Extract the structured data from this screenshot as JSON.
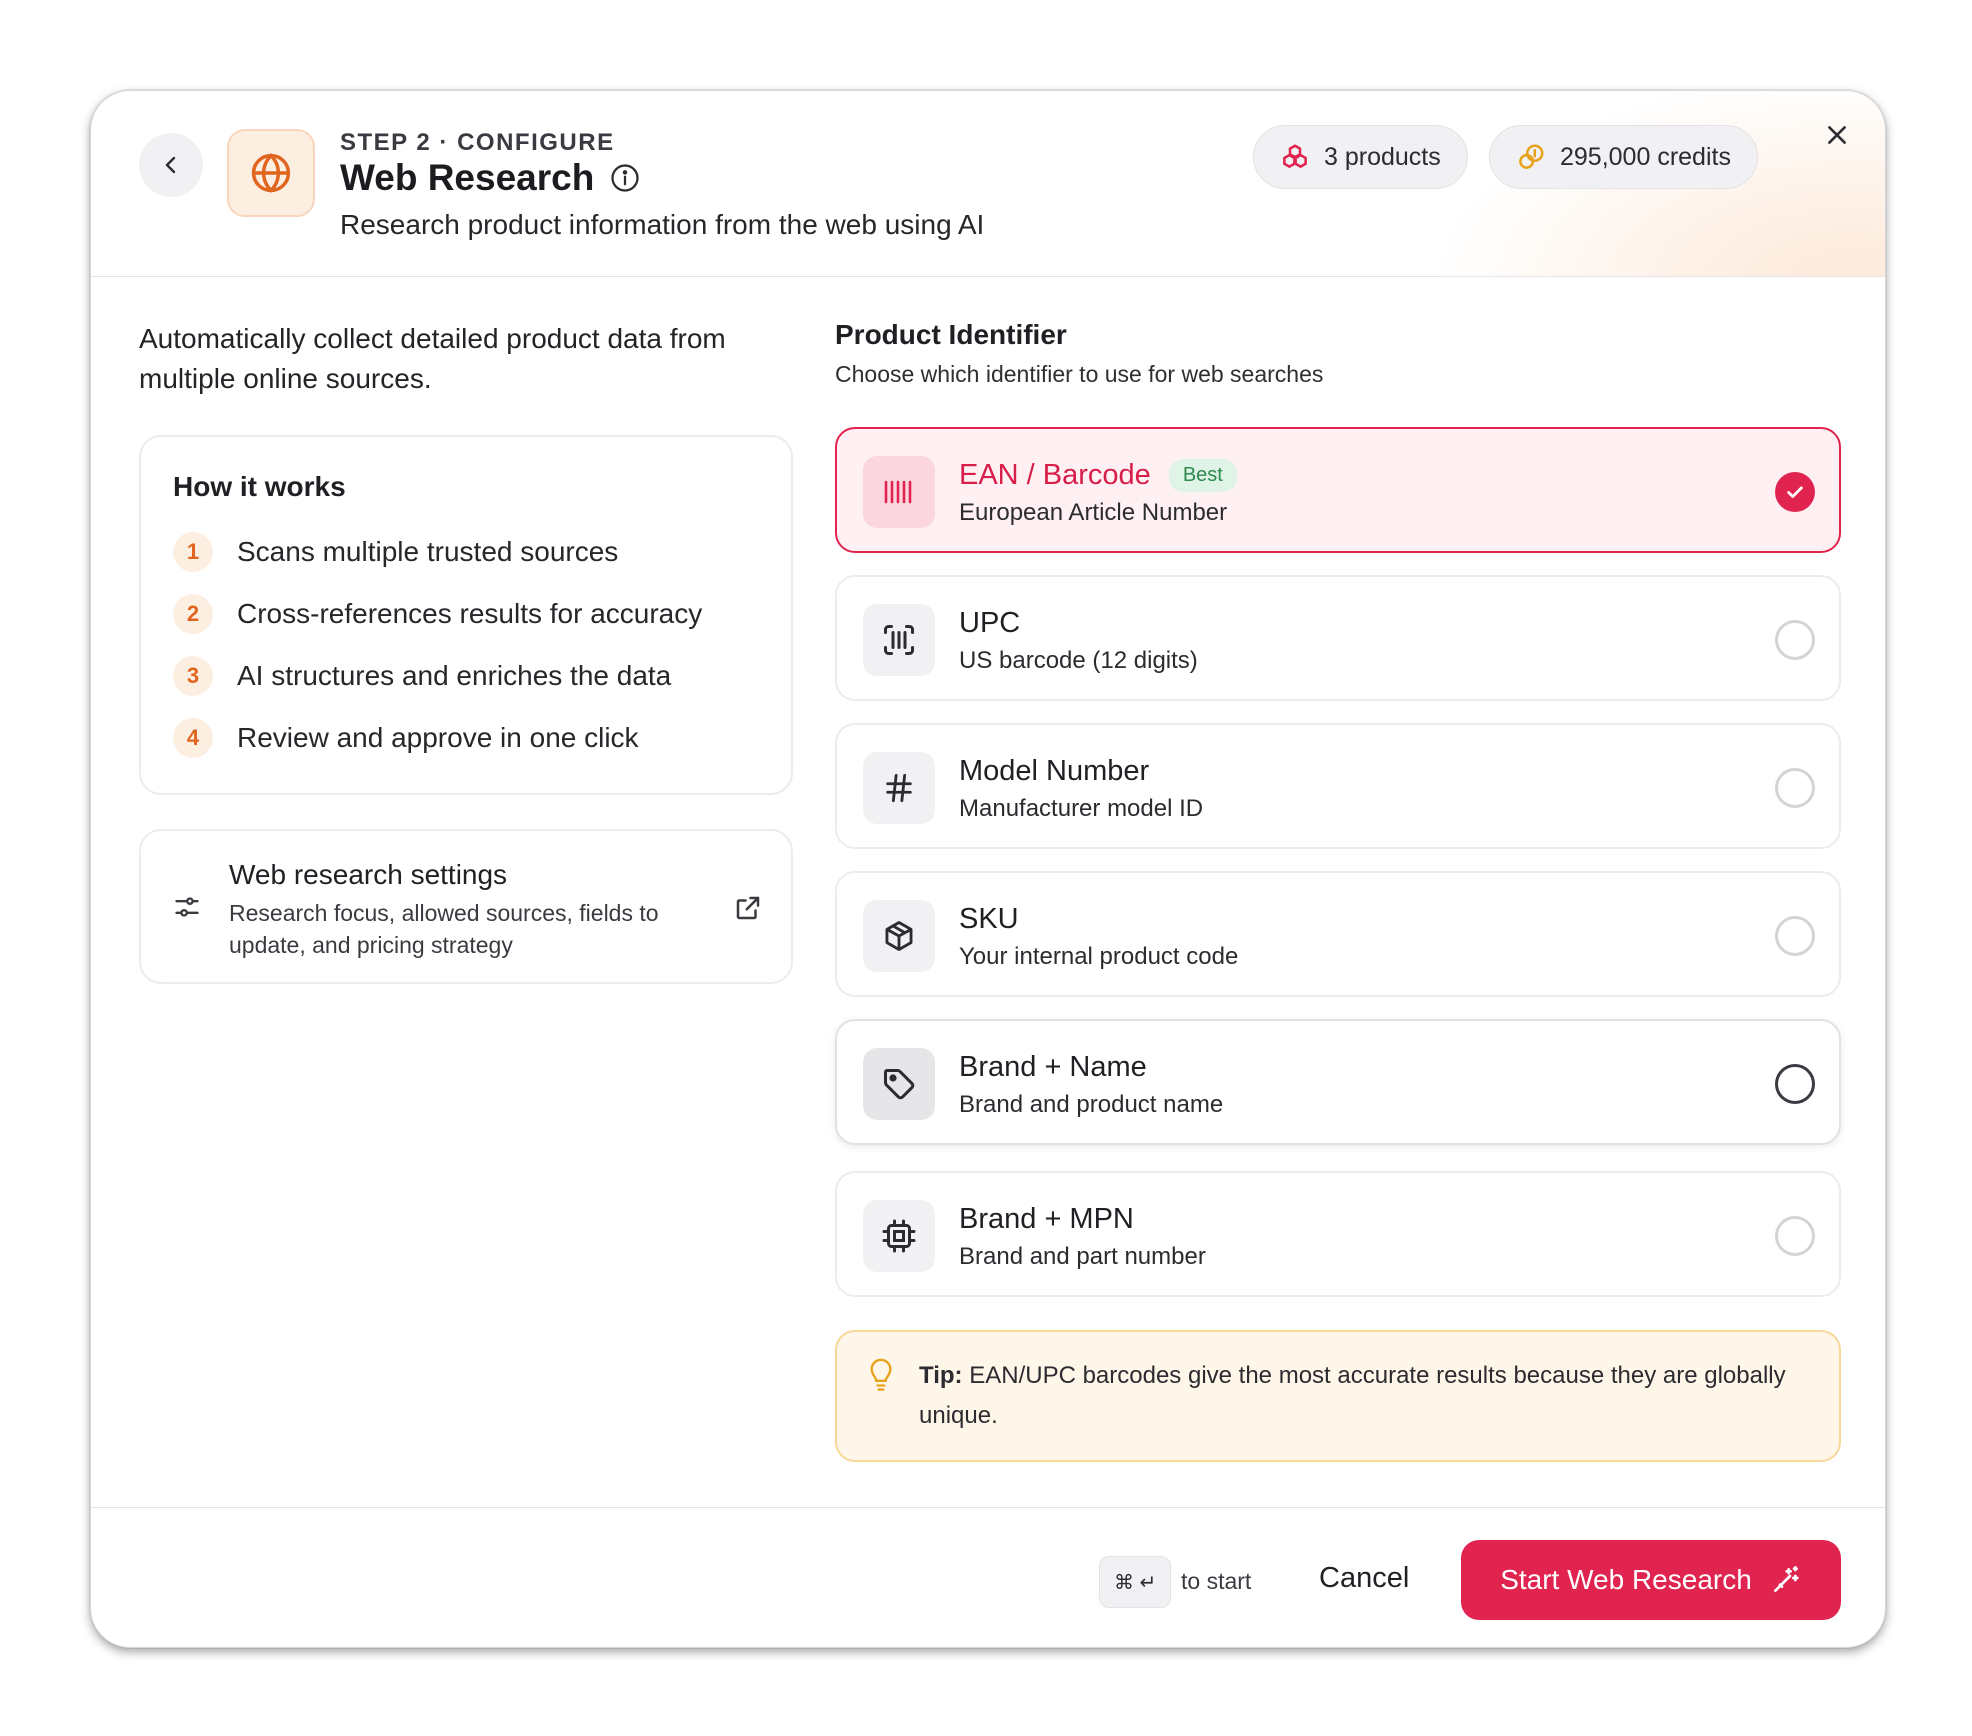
{
  "header": {
    "step": "STEP 2 · CONFIGURE",
    "title": "Web Research",
    "subtitle": "Research product information from the web using AI",
    "products_pill": "3 products",
    "credits_pill": "295,000 credits"
  },
  "left": {
    "intro": "Automatically collect detailed product data from multiple online sources.",
    "how_title": "How it works",
    "steps": [
      {
        "num": "1",
        "text": "Scans multiple trusted sources"
      },
      {
        "num": "2",
        "text": "Cross-references results for accuracy"
      },
      {
        "num": "3",
        "text": "AI structures and enriches the data"
      },
      {
        "num": "4",
        "text": "Review and approve in one click"
      }
    ],
    "settings_title": "Web research settings",
    "settings_desc": "Research focus, allowed sources, fields to update, and pricing strategy"
  },
  "right": {
    "title": "Product Identifier",
    "subtitle": "Choose which identifier to use for web searches",
    "options": [
      {
        "label": "EAN / Barcode",
        "badge": "Best",
        "desc": "European Article Number",
        "icon": "barcode-icon",
        "selected": true
      },
      {
        "label": "UPC",
        "desc": "US barcode (12 digits)",
        "icon": "scan-barcode-icon",
        "selected": false
      },
      {
        "label": "Model Number",
        "desc": "Manufacturer model ID",
        "icon": "hash-icon",
        "selected": false
      },
      {
        "label": "SKU",
        "desc": "Your internal product code",
        "icon": "package-icon",
        "selected": false
      },
      {
        "label": "Brand + Name",
        "desc": "Brand and product name",
        "icon": "tag-icon",
        "selected": false
      },
      {
        "label": "Brand + MPN",
        "desc": "Brand and part number",
        "icon": "chip-icon",
        "selected": false
      }
    ],
    "tip_label": "Tip:",
    "tip_text": "EAN/UPC barcodes give the most accurate results because they are globally unique."
  },
  "footer": {
    "shortcut": "⌘ ↵",
    "shortcut_hint": "to start",
    "cancel": "Cancel",
    "start": "Start Web Research"
  },
  "colors": {
    "accent": "#e0244f",
    "orange": "#e0651f",
    "success": "#2d8a4e"
  }
}
